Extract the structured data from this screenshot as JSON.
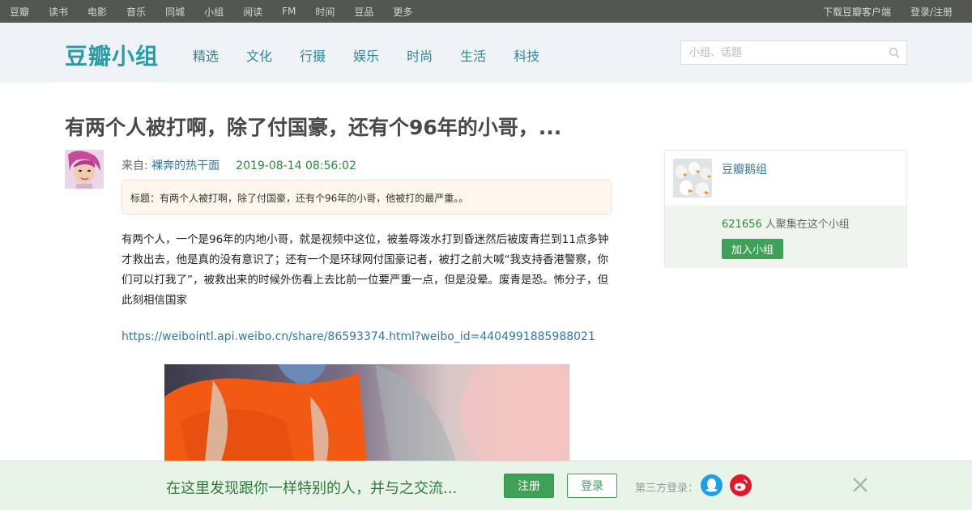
{
  "topbar": {
    "left_links": [
      "豆瓣",
      "读书",
      "电影",
      "音乐",
      "同城",
      "小组",
      "阅读",
      "FM",
      "时间",
      "豆品",
      "更多"
    ],
    "download_label": "下载豆瓣客户端",
    "login_label": "登录/注册"
  },
  "header": {
    "logo": "豆瓣小组",
    "nav": [
      "精选",
      "文化",
      "行摄",
      "娱乐",
      "时尚",
      "生活",
      "科技"
    ],
    "search_placeholder": "小组、话题"
  },
  "post": {
    "title": "有两个人被打啊，除了付国豪，还有个96年的小哥，...",
    "from_label": "来自: ",
    "author": "裸奔的热干面",
    "date": "2019-08-14 08:56:02",
    "subject": "标题：有两个人被打啊，除了付国豪，还有个96年的小哥，他被打的最严重。。",
    "content": "有两个人，一个是96年的内地小哥，就是视频中这位，被羞辱泼水打到昏迷然后被废青拦到11点多钟才救出去，他是真的没有意识了；还有一个是环球网付国豪记者，被打之前大喊“我支持香港警察，你们可以打我了”，被救出来的时候外伤看上去比前一位要严重一点，但是没晕。废青是恐。怖分子，但此刻相信国家",
    "link": "https://weibointl.api.weibo.cn/share/86593374.html?weibo_id=4404991885988021"
  },
  "group_card": {
    "name": "豆瓣鹅组",
    "member_count": "621656",
    "member_suffix": " 人聚集在这个小组",
    "join_label": "加入小组"
  },
  "promo": {
    "slogan": "在这里发现跟你一样特别的人，并与之交流...",
    "register_label": "注册",
    "login_label": "登录",
    "third_party_label": "第三方登录："
  },
  "colors": {
    "topbar_bg": "#545652",
    "header_bg": "#f0f3f5",
    "brand": "#2b9bab",
    "link": "#3377aa",
    "green": "#3fa156"
  }
}
